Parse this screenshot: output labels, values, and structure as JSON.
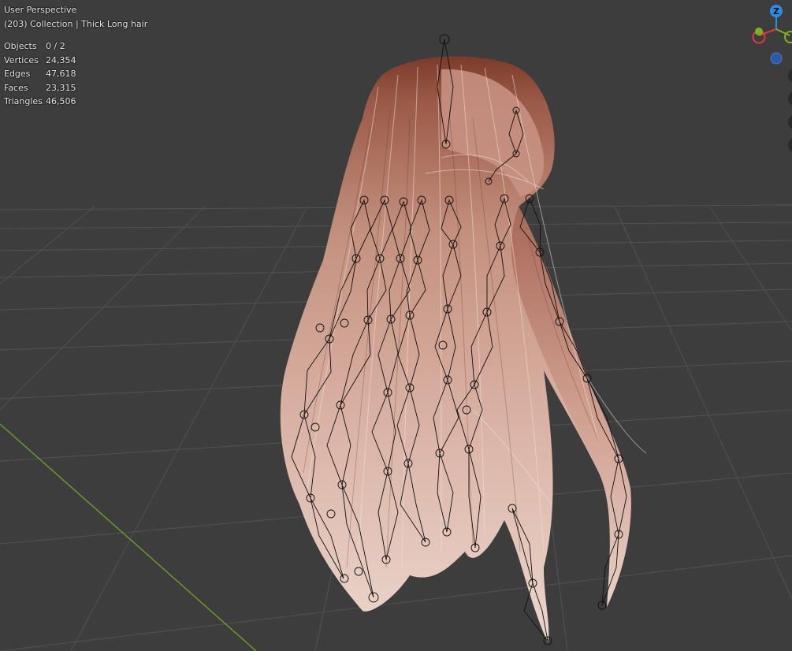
{
  "viewport": {
    "view_name": "User Perspective",
    "context": "(203) Collection | Thick Long hair"
  },
  "stats": [
    {
      "label": "Objects",
      "value": "0 / 2"
    },
    {
      "label": "Vertices",
      "value": "24,354"
    },
    {
      "label": "Edges",
      "value": "47,618"
    },
    {
      "label": "Faces",
      "value": "23,315"
    },
    {
      "label": "Triangles",
      "value": "46,506"
    }
  ],
  "gizmo": {
    "z_label": "Z",
    "axis_colors": {
      "x": "#e0384a",
      "y": "#7fb21f",
      "z": "#2c8de8"
    }
  },
  "colors": {
    "background": "#3d3d3d",
    "grid": "#545454",
    "x_axis_line": "#6a9a2a",
    "hair_root": "#8a4a38",
    "hair_tip": "#e6ccc2"
  }
}
